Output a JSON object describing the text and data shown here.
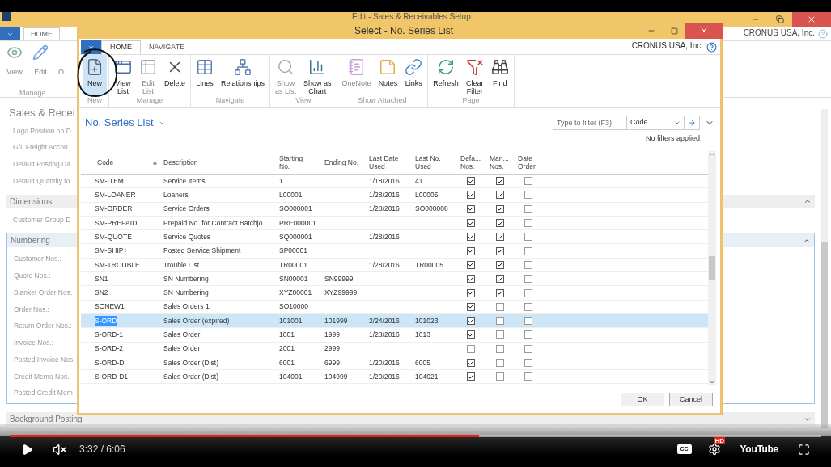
{
  "background_window": {
    "title": "Edit - Sales & Receivables Setup",
    "tabs": [
      {
        "label": "HOME",
        "selected": true
      }
    ],
    "ribbon": {
      "buttons": [
        {
          "label": "View",
          "kind": "view"
        },
        {
          "label": "Edit",
          "kind": "edit"
        },
        {
          "label": "O",
          "kind": "text"
        }
      ],
      "group": "Manage"
    },
    "company": "CRONUS USA, Inc.",
    "page_title": "Sales & Recei",
    "general_fields": [
      "Logo Position on D",
      "G/L Freight Accou",
      "Default Posting Da",
      "Default Quantity to"
    ],
    "sections": [
      {
        "title": "Dimensions",
        "expanded": true,
        "focused": false,
        "fields": [
          "Customer Group D"
        ]
      },
      {
        "title": "Numbering",
        "expanded": true,
        "focused": true,
        "fields": [
          "Customer Nos.:",
          "Quote Nos.:",
          "Blanket Order Nos.",
          "Order Nos.:",
          "Return Order Nos.:",
          "Invoice Nos.:",
          "Posted Invoice Nos",
          "Credit Memo Nos.:",
          "Posted Credit Mem"
        ]
      },
      {
        "title": "Background Posting",
        "expanded": false,
        "focused": false
      }
    ]
  },
  "dialog": {
    "title": "Select - No. Series List",
    "tabs": [
      {
        "label": "HOME",
        "selected": true
      },
      {
        "label": "NAVIGATE",
        "selected": false
      }
    ],
    "company": "CRONUS USA, Inc.",
    "ribbon_groups": [
      {
        "label": "New",
        "buttons": [
          {
            "label": "New",
            "kind": "new",
            "selected": true,
            "disabled": false
          }
        ]
      },
      {
        "label": "Manage",
        "buttons": [
          {
            "label": "View\nList",
            "kind": "viewlist",
            "selected": false,
            "disabled": false
          },
          {
            "label": "Edit\nList",
            "kind": "editlist",
            "selected": false,
            "disabled": true
          },
          {
            "label": "Delete",
            "kind": "delete",
            "selected": false,
            "disabled": false
          }
        ]
      },
      {
        "label": "Navigate",
        "buttons": [
          {
            "label": "Lines",
            "kind": "lines",
            "selected": false,
            "disabled": false
          },
          {
            "label": "Relationships",
            "kind": "relationships",
            "selected": false,
            "disabled": false
          }
        ]
      },
      {
        "label": "View",
        "buttons": [
          {
            "label": "Show\nas List",
            "kind": "showlist",
            "selected": false,
            "disabled": true
          },
          {
            "label": "Show as\nChart",
            "kind": "chart",
            "selected": false,
            "disabled": false
          }
        ]
      },
      {
        "label": "Show Attached",
        "buttons": [
          {
            "label": "OneNote",
            "kind": "onenote",
            "selected": false,
            "disabled": true
          },
          {
            "label": "Notes",
            "kind": "notes",
            "selected": false,
            "disabled": false
          },
          {
            "label": "Links",
            "kind": "links",
            "selected": false,
            "disabled": false
          }
        ]
      },
      {
        "label": "Page",
        "buttons": [
          {
            "label": "Refresh",
            "kind": "refresh",
            "selected": false,
            "disabled": false
          },
          {
            "label": "Clear\nFilter",
            "kind": "clearfilter",
            "selected": false,
            "disabled": false
          },
          {
            "label": "Find",
            "kind": "find",
            "selected": false,
            "disabled": false
          }
        ]
      }
    ],
    "list_title": "No. Series List",
    "filter": {
      "placeholder": "Type to filter (F3)",
      "field": "Code"
    },
    "filter_status": "No filters applied",
    "columns": [
      "Code",
      "Description",
      "Starting\nNo.",
      "Ending No.",
      "Last Date\nUsed",
      "Last No.\nUsed",
      "Defa...\nNos.",
      "Man...\nNos.",
      "Date\nOrder"
    ],
    "rows": [
      {
        "code": "SM-ITEM",
        "description": "Service Items",
        "starting_no": "1",
        "last_date_used": "1/18/2016",
        "last_no_used": "41",
        "default_nos": true,
        "manual_nos": true,
        "date_order": false,
        "selected": false
      },
      {
        "code": "SM-LOANER",
        "description": "Loaners",
        "starting_no": "L00001",
        "last_date_used": "1/28/2016",
        "last_no_used": "L00005",
        "default_nos": true,
        "manual_nos": true,
        "date_order": false,
        "selected": false
      },
      {
        "code": "SM-ORDER",
        "description": "Service Orders",
        "starting_no": "SO000001",
        "last_date_used": "1/28/2016",
        "last_no_used": "SO000008",
        "default_nos": true,
        "manual_nos": true,
        "date_order": false,
        "selected": false
      },
      {
        "code": "SM-PREPAID",
        "description": "Prepaid No. for Contract Batchjo...",
        "starting_no": "PRE000001",
        "default_nos": true,
        "manual_nos": true,
        "date_order": false,
        "selected": false
      },
      {
        "code": "SM-QUOTE",
        "description": "Service Quotes",
        "starting_no": "SQ000001",
        "last_date_used": "1/28/2016",
        "default_nos": true,
        "manual_nos": true,
        "date_order": false,
        "selected": false
      },
      {
        "code": "SM-SHIP+",
        "description": "Posted Service Shipment",
        "starting_no": "SP00001",
        "default_nos": true,
        "manual_nos": true,
        "date_order": false,
        "selected": false
      },
      {
        "code": "SM-TROUBLE",
        "description": "Trouble List",
        "starting_no": "TR00001",
        "last_date_used": "1/28/2016",
        "last_no_used": "TR00005",
        "default_nos": true,
        "manual_nos": true,
        "date_order": false,
        "selected": false
      },
      {
        "code": "SN1",
        "description": "SN Numbering",
        "starting_no": "SN00001",
        "ending_no": "SN99999",
        "default_nos": true,
        "manual_nos": true,
        "date_order": false,
        "selected": false
      },
      {
        "code": "SN2",
        "description": "SN Numbering",
        "starting_no": "XYZ00001",
        "ending_no": "XYZ99999",
        "default_nos": true,
        "manual_nos": true,
        "date_order": false,
        "selected": false
      },
      {
        "code": "SONEW1",
        "description": "Sales Orders 1",
        "starting_no": "SO10000",
        "default_nos": true,
        "manual_nos": false,
        "date_order": false,
        "selected": false
      },
      {
        "code": "S-ORD",
        "description": "Sales Order (expired)",
        "starting_no": "101001",
        "ending_no": "101999",
        "last_date_used": "2/24/2016",
        "last_no_used": "101023",
        "default_nos": true,
        "manual_nos": false,
        "date_order": false,
        "selected": true
      },
      {
        "code": "S-ORD-1",
        "description": "Sales Order",
        "starting_no": "1001",
        "ending_no": "1999",
        "last_date_used": "1/28/2016",
        "last_no_used": "1013",
        "default_nos": true,
        "manual_nos": false,
        "date_order": false,
        "selected": false
      },
      {
        "code": "S-ORD-2",
        "description": "Sales Order",
        "starting_no": "2001",
        "ending_no": "2999",
        "default_nos": false,
        "manual_nos": false,
        "date_order": false,
        "selected": false
      },
      {
        "code": "S-ORD-D",
        "description": "Sales Order (Dist)",
        "starting_no": "6001",
        "ending_no": "6999",
        "last_date_used": "1/20/2016",
        "last_no_used": "6005",
        "default_nos": true,
        "manual_nos": false,
        "date_order": false,
        "selected": false
      },
      {
        "code": "S-ORD-D1",
        "description": "Sales Order (Dist)",
        "starting_no": "104001",
        "ending_no": "104999",
        "last_date_used": "1/20/2016",
        "last_no_used": "104021",
        "default_nos": true,
        "manual_nos": false,
        "date_order": false,
        "selected": false
      }
    ],
    "buttons": [
      "OK",
      "Cancel"
    ]
  },
  "video_player": {
    "progress": {
      "level": 0.578
    },
    "time": "3:32 / 6:06",
    "cc_label": "CC",
    "hd_badge": "HD",
    "logo": "YouTube"
  }
}
